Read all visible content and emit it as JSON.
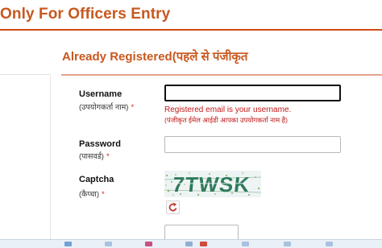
{
  "header": {
    "title": "Only For Officers Entry"
  },
  "login": {
    "heading": "Already Registered(पहले से पंजीकृत",
    "username": {
      "label": "Username",
      "label_hi": "(उपयोगकर्ता नाम)",
      "required": "*",
      "value": "",
      "hint_en": "Registered email is your username.",
      "hint_hi": "(पंजीकृत ईमेल आईडी आपका उपयोगकर्ता नाम है)"
    },
    "password": {
      "label": "Password",
      "label_hi": "(पासवर्ड)",
      "required": "*",
      "value": ""
    },
    "captcha": {
      "label": "Captcha",
      "label_hi": "(कैप्चा)",
      "required": "*",
      "image_text": "7TWSK",
      "refresh_icon": "refresh-icon",
      "value": ""
    }
  },
  "colors": {
    "brand": "#c8581f",
    "rule": "#d24a16",
    "error": "#c01818",
    "captcha_text": "#2f7a5a"
  }
}
